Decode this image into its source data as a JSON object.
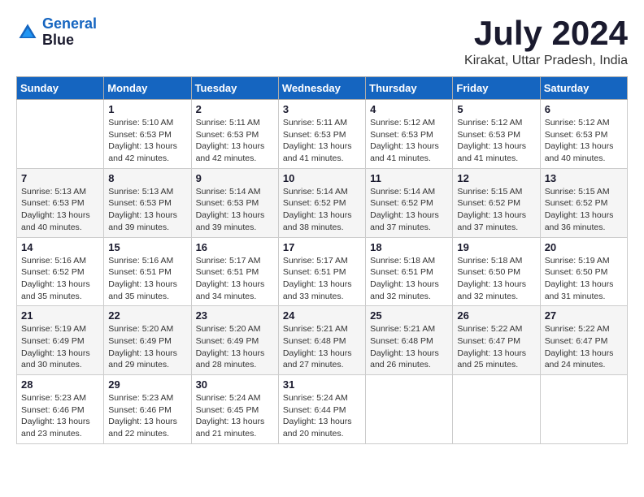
{
  "header": {
    "logo_line1": "General",
    "logo_line2": "Blue",
    "month_year": "July 2024",
    "location": "Kirakat, Uttar Pradesh, India"
  },
  "days_of_week": [
    "Sunday",
    "Monday",
    "Tuesday",
    "Wednesday",
    "Thursday",
    "Friday",
    "Saturday"
  ],
  "weeks": [
    [
      {
        "day": "",
        "info": ""
      },
      {
        "day": "1",
        "info": "Sunrise: 5:10 AM\nSunset: 6:53 PM\nDaylight: 13 hours\nand 42 minutes."
      },
      {
        "day": "2",
        "info": "Sunrise: 5:11 AM\nSunset: 6:53 PM\nDaylight: 13 hours\nand 42 minutes."
      },
      {
        "day": "3",
        "info": "Sunrise: 5:11 AM\nSunset: 6:53 PM\nDaylight: 13 hours\nand 41 minutes."
      },
      {
        "day": "4",
        "info": "Sunrise: 5:12 AM\nSunset: 6:53 PM\nDaylight: 13 hours\nand 41 minutes."
      },
      {
        "day": "5",
        "info": "Sunrise: 5:12 AM\nSunset: 6:53 PM\nDaylight: 13 hours\nand 41 minutes."
      },
      {
        "day": "6",
        "info": "Sunrise: 5:12 AM\nSunset: 6:53 PM\nDaylight: 13 hours\nand 40 minutes."
      }
    ],
    [
      {
        "day": "7",
        "info": "Sunrise: 5:13 AM\nSunset: 6:53 PM\nDaylight: 13 hours\nand 40 minutes."
      },
      {
        "day": "8",
        "info": "Sunrise: 5:13 AM\nSunset: 6:53 PM\nDaylight: 13 hours\nand 39 minutes."
      },
      {
        "day": "9",
        "info": "Sunrise: 5:14 AM\nSunset: 6:53 PM\nDaylight: 13 hours\nand 39 minutes."
      },
      {
        "day": "10",
        "info": "Sunrise: 5:14 AM\nSunset: 6:52 PM\nDaylight: 13 hours\nand 38 minutes."
      },
      {
        "day": "11",
        "info": "Sunrise: 5:14 AM\nSunset: 6:52 PM\nDaylight: 13 hours\nand 37 minutes."
      },
      {
        "day": "12",
        "info": "Sunrise: 5:15 AM\nSunset: 6:52 PM\nDaylight: 13 hours\nand 37 minutes."
      },
      {
        "day": "13",
        "info": "Sunrise: 5:15 AM\nSunset: 6:52 PM\nDaylight: 13 hours\nand 36 minutes."
      }
    ],
    [
      {
        "day": "14",
        "info": "Sunrise: 5:16 AM\nSunset: 6:52 PM\nDaylight: 13 hours\nand 35 minutes."
      },
      {
        "day": "15",
        "info": "Sunrise: 5:16 AM\nSunset: 6:51 PM\nDaylight: 13 hours\nand 35 minutes."
      },
      {
        "day": "16",
        "info": "Sunrise: 5:17 AM\nSunset: 6:51 PM\nDaylight: 13 hours\nand 34 minutes."
      },
      {
        "day": "17",
        "info": "Sunrise: 5:17 AM\nSunset: 6:51 PM\nDaylight: 13 hours\nand 33 minutes."
      },
      {
        "day": "18",
        "info": "Sunrise: 5:18 AM\nSunset: 6:51 PM\nDaylight: 13 hours\nand 32 minutes."
      },
      {
        "day": "19",
        "info": "Sunrise: 5:18 AM\nSunset: 6:50 PM\nDaylight: 13 hours\nand 32 minutes."
      },
      {
        "day": "20",
        "info": "Sunrise: 5:19 AM\nSunset: 6:50 PM\nDaylight: 13 hours\nand 31 minutes."
      }
    ],
    [
      {
        "day": "21",
        "info": "Sunrise: 5:19 AM\nSunset: 6:49 PM\nDaylight: 13 hours\nand 30 minutes."
      },
      {
        "day": "22",
        "info": "Sunrise: 5:20 AM\nSunset: 6:49 PM\nDaylight: 13 hours\nand 29 minutes."
      },
      {
        "day": "23",
        "info": "Sunrise: 5:20 AM\nSunset: 6:49 PM\nDaylight: 13 hours\nand 28 minutes."
      },
      {
        "day": "24",
        "info": "Sunrise: 5:21 AM\nSunset: 6:48 PM\nDaylight: 13 hours\nand 27 minutes."
      },
      {
        "day": "25",
        "info": "Sunrise: 5:21 AM\nSunset: 6:48 PM\nDaylight: 13 hours\nand 26 minutes."
      },
      {
        "day": "26",
        "info": "Sunrise: 5:22 AM\nSunset: 6:47 PM\nDaylight: 13 hours\nand 25 minutes."
      },
      {
        "day": "27",
        "info": "Sunrise: 5:22 AM\nSunset: 6:47 PM\nDaylight: 13 hours\nand 24 minutes."
      }
    ],
    [
      {
        "day": "28",
        "info": "Sunrise: 5:23 AM\nSunset: 6:46 PM\nDaylight: 13 hours\nand 23 minutes."
      },
      {
        "day": "29",
        "info": "Sunrise: 5:23 AM\nSunset: 6:46 PM\nDaylight: 13 hours\nand 22 minutes."
      },
      {
        "day": "30",
        "info": "Sunrise: 5:24 AM\nSunset: 6:45 PM\nDaylight: 13 hours\nand 21 minutes."
      },
      {
        "day": "31",
        "info": "Sunrise: 5:24 AM\nSunset: 6:44 PM\nDaylight: 13 hours\nand 20 minutes."
      },
      {
        "day": "",
        "info": ""
      },
      {
        "day": "",
        "info": ""
      },
      {
        "day": "",
        "info": ""
      }
    ]
  ]
}
